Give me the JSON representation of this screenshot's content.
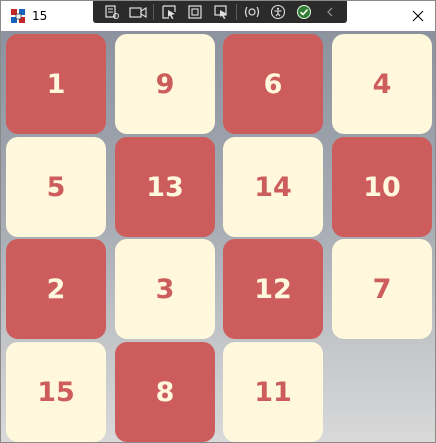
{
  "window": {
    "title": "15"
  },
  "toolbar": {
    "icons": [
      "select-element-icon",
      "display-layout-adorners-icon",
      "track-focused-element-icon",
      "toggle-visibility-icon",
      "preview-selection-icon",
      "hot-reload-icon",
      "accessibility-icon",
      "checkmark-status-icon",
      "collapse-chevron-icon"
    ]
  },
  "board": {
    "tiles": [
      {
        "label": "1",
        "color": "red"
      },
      {
        "label": "9",
        "color": "cream"
      },
      {
        "label": "6",
        "color": "red"
      },
      {
        "label": "4",
        "color": "cream"
      },
      {
        "label": "5",
        "color": "cream"
      },
      {
        "label": "13",
        "color": "red"
      },
      {
        "label": "14",
        "color": "cream"
      },
      {
        "label": "10",
        "color": "red"
      },
      {
        "label": "2",
        "color": "red"
      },
      {
        "label": "3",
        "color": "cream"
      },
      {
        "label": "12",
        "color": "red"
      },
      {
        "label": "7",
        "color": "cream"
      },
      {
        "label": "15",
        "color": "cream"
      },
      {
        "label": "8",
        "color": "red"
      },
      {
        "label": "11",
        "color": "cream"
      }
    ]
  },
  "colors": {
    "tile_red": "#cd5c5c",
    "tile_cream": "#fff8dc"
  }
}
